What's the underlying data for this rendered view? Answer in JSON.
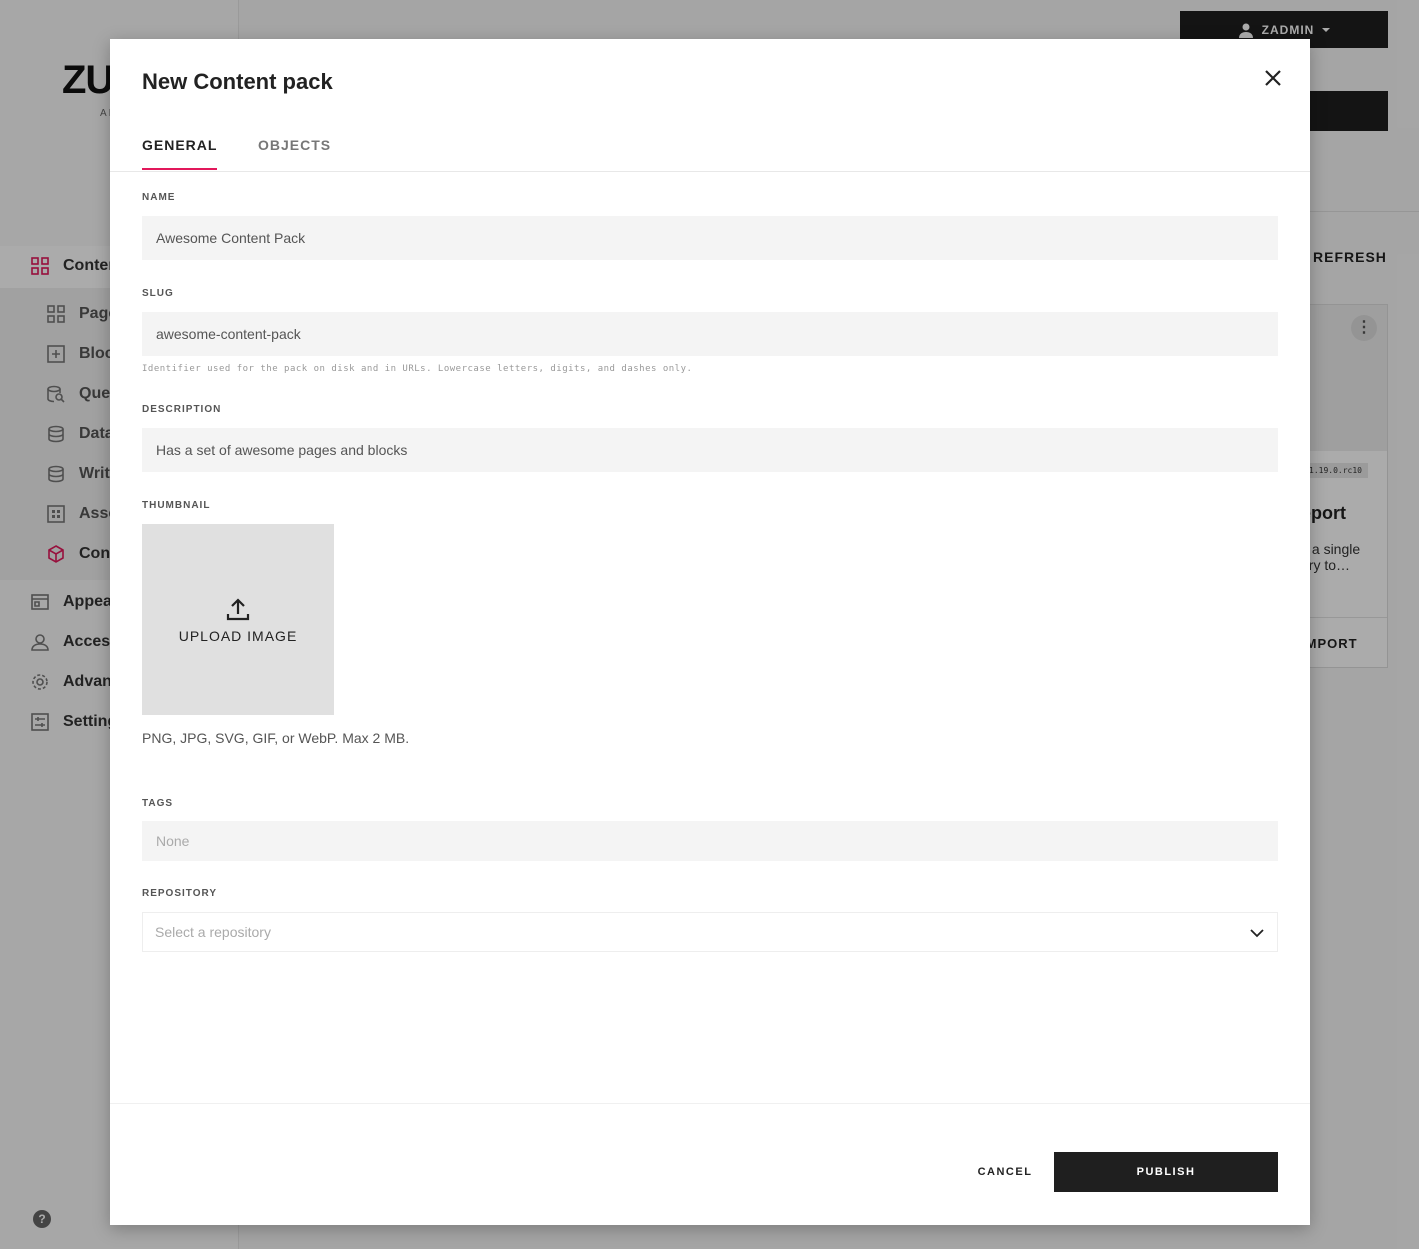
{
  "background": {
    "logo": "ZU",
    "logo_sub": "AI",
    "user": "ZADMIN",
    "refresh": "REFRESH",
    "nav": [
      {
        "label": "Conter",
        "icon": "grid-icon"
      },
      {
        "label": "Page",
        "icon": "pages-icon"
      },
      {
        "label": "Bloc",
        "icon": "blocks-icon"
      },
      {
        "label": "Quer",
        "icon": "query-icon"
      },
      {
        "label": "Data",
        "icon": "database-icon"
      },
      {
        "label": "Write",
        "icon": "database-write-icon"
      },
      {
        "label": "Asse",
        "icon": "assets-icon"
      },
      {
        "label": "Cont",
        "icon": "cube-icon"
      },
      {
        "label": "Appea",
        "icon": "appearance-icon"
      },
      {
        "label": "Access",
        "icon": "user-icon"
      },
      {
        "label": "Advanc",
        "icon": "gear-icon"
      },
      {
        "label": "Setting",
        "icon": "settings-icon"
      }
    ],
    "card": {
      "version": "1.19.0.rc10",
      "title": "eport",
      "description": "s a single ery to…",
      "action": "IMPORT"
    },
    "help": "?"
  },
  "modal": {
    "title": "New Content pack",
    "tabs": [
      {
        "label": "GENERAL",
        "active": true
      },
      {
        "label": "OBJECTS",
        "active": false
      }
    ],
    "name": {
      "label": "NAME",
      "value": "Awesome Content Pack"
    },
    "slug": {
      "label": "SLUG",
      "value": "awesome-content-pack",
      "help": "Identifier used for the pack on disk and in URLs. Lowercase letters, digits, and dashes only."
    },
    "description": {
      "label": "DESCRIPTION",
      "value": "Has a set of awesome pages and blocks"
    },
    "thumbnail": {
      "label": "THUMBNAIL",
      "upload_label": "UPLOAD IMAGE",
      "hint": "PNG, JPG, SVG, GIF, or WebP. Max 2 MB."
    },
    "tags": {
      "label": "TAGS",
      "placeholder": "None"
    },
    "repository": {
      "label": "REPOSITORY",
      "placeholder": "Select a repository"
    },
    "cancel_label": "CANCEL",
    "publish_label": "PUBLISH"
  },
  "colors": {
    "accent": "#e2185b",
    "dark": "#1f1f1f",
    "field_bg": "#f4f4f4"
  }
}
